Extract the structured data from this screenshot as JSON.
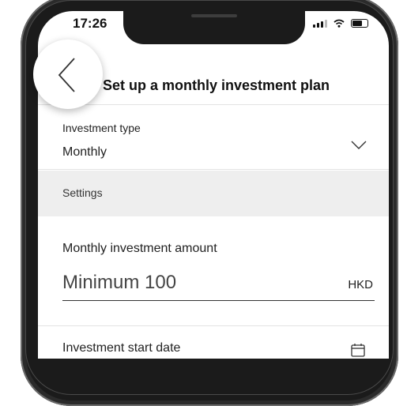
{
  "status": {
    "time": "17:26"
  },
  "header": {
    "title": "Set up a monthly investment plan",
    "back_icon": "chevron-left-icon"
  },
  "investment_type": {
    "label": "Investment type",
    "value": "Monthly",
    "icon": "chevron-down-icon"
  },
  "settings": {
    "section_label": "Settings"
  },
  "amount": {
    "label": "Monthly investment amount",
    "placeholder": "Minimum 100",
    "currency": "HKD"
  },
  "start_date": {
    "label": "Investment start date",
    "icon": "calendar-icon"
  }
}
